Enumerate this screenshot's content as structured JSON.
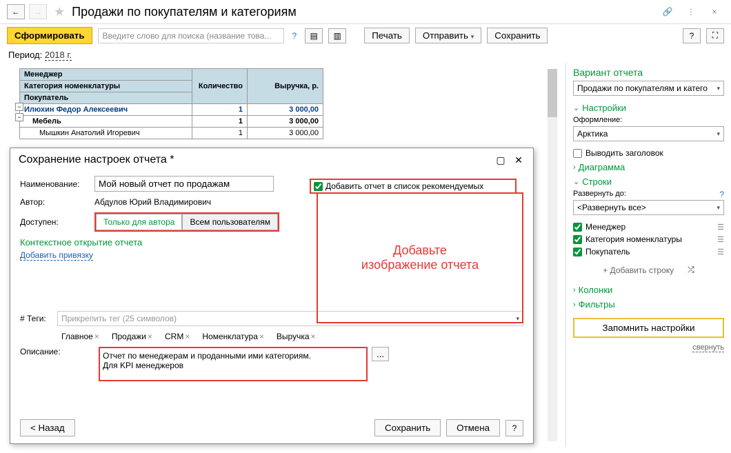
{
  "header": {
    "title": "Продажи по покупателям и категориям"
  },
  "toolbar": {
    "generate": "Сформировать",
    "search_placeholder": "Введите слово для поиска (название това...",
    "print": "Печать",
    "send": "Отправить",
    "save": "Сохранить"
  },
  "period": {
    "label": "Период:",
    "value": "2018 г."
  },
  "table": {
    "col_manager": "Менеджер",
    "col_category": "Категория номенклатуры",
    "col_buyer": "Покупатель",
    "col_qty": "Количество",
    "col_revenue": "Выручка, р.",
    "rows": [
      {
        "name": "Илюхин Федор Алексеевич",
        "qty": "1",
        "rev": "3 000,00",
        "lvl": 1
      },
      {
        "name": "Мебель",
        "qty": "1",
        "rev": "3 000,00",
        "lvl": 2
      },
      {
        "name": "Мышкин Анатолий Игоревич",
        "qty": "1",
        "rev": "3 000,00",
        "lvl": 3
      }
    ]
  },
  "dialog": {
    "title": "Сохранение настроек отчета *",
    "name_label": "Наименование:",
    "name_value": "Мой новый отчет по продажам",
    "recommend": "Добавить отчет в список рекомендуемых",
    "author_label": "Автор:",
    "author_value": "Абдулов Юрий Владимирович",
    "access_label": "Доступен:",
    "access_author": "Только для автора",
    "access_all": "Всем пользователям",
    "context_heading": "Контекстное открытие отчета",
    "add_binding": "Добавить привязку",
    "image_line1": "Добавьте",
    "image_line2": "изображение отчета",
    "tags_label": "# Теги:",
    "tags_placeholder": "Прикрепить тег (25 символов)",
    "tags": [
      "Главное",
      "Продажи",
      "CRM",
      "Номенклатура",
      "Выручка"
    ],
    "desc_label": "Описание:",
    "desc_value": "Отчет по менеджерам и проданными ими категориям.\nДля KPI менеджеров",
    "back": "Назад",
    "save": "Сохранить",
    "cancel": "Отмена"
  },
  "right": {
    "variant_heading": "Вариант отчета",
    "variant_value": "Продажи по покупателям и катего",
    "settings": "Настройки",
    "design_label": "Оформление:",
    "design_value": "Арктика",
    "show_title": "Выводить заголовок",
    "diagram": "Диаграмма",
    "rows_heading": "Строки",
    "expand_label": "Развернуть до:",
    "expand_value": "<Развернуть все>",
    "rows": [
      "Менеджер",
      "Категория номенклатуры",
      "Покупатель"
    ],
    "add_row": "+ Добавить строку",
    "columns": "Колонки",
    "filters": "Фильтры",
    "remember": "Запомнить настройки",
    "collapse": "свернуть"
  }
}
